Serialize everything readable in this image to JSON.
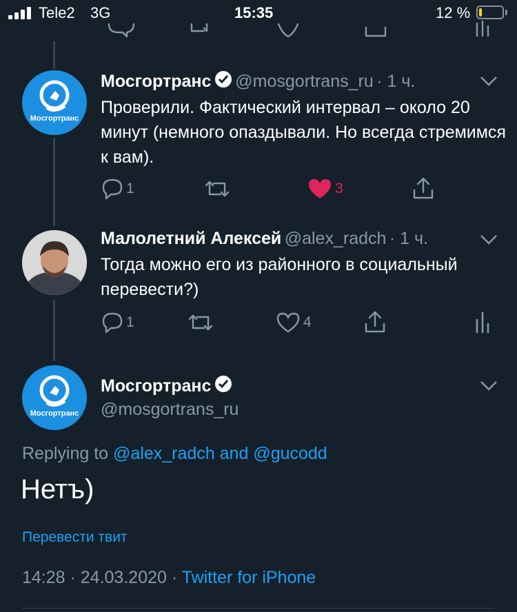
{
  "status_bar": {
    "carrier": "Tele2",
    "network": "3G",
    "time": "15:35",
    "battery_percent_text": "12 %",
    "battery_level": 0.12
  },
  "tweets": [
    {
      "name": "Мосгортранс",
      "handle": "@mosgortrans_ru",
      "time": "· 1 ч.",
      "text": "Проверили. Фактический интервал – около 20 минут (немного опаздывали. Но всегда стремимся к вам).",
      "replies": "1",
      "likes": "3",
      "avatar_label": "Мосгортранс"
    },
    {
      "name": "Малолетний Алексей",
      "handle": "@alex_radch",
      "time": "· 1 ч.",
      "text": "Тогда можно его из районного в социальный перевести?)",
      "replies": "1",
      "likes": "4"
    }
  ],
  "main_tweet": {
    "name": "Мосгортранс",
    "handle": "@mosgortrans_ru",
    "avatar_label": "Мосгортранс",
    "replying_prefix": "Replying to",
    "replying_to": "@alex_radch and @gucodd",
    "text": "Нетъ)",
    "translate": "Перевести твит",
    "timestamp": "14:28 · 24.03.2020 ·",
    "source": "Twitter for iPhone"
  },
  "colors": {
    "background": "#15202b",
    "accent": "#1da1f2",
    "like": "#e0245e",
    "muted": "#8899a6"
  }
}
